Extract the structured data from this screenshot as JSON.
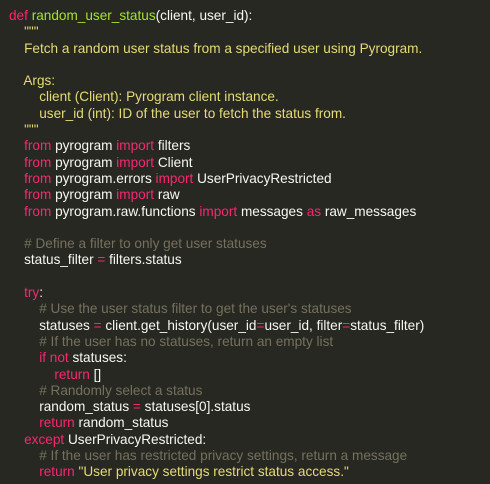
{
  "editor": {
    "background": "#272822",
    "colors": {
      "keyword": "#f92672",
      "function": "#a6e22e",
      "string": "#e6db74",
      "comment": "#75715e",
      "text": "#f8f8f2"
    },
    "lines": [
      [
        {
          "t": "def",
          "c": "kw"
        },
        {
          "t": " ",
          "c": "pl"
        },
        {
          "t": "random_user_status",
          "c": "fn"
        },
        {
          "t": "(client, user_id):",
          "c": "pl"
        }
      ],
      [
        {
          "t": "    \"\"\"",
          "c": "doc"
        }
      ],
      [
        {
          "t": "    Fetch a random user status from a specified user using Pyrogram.",
          "c": "doc"
        }
      ],
      [
        {
          "t": "",
          "c": "pl"
        }
      ],
      [
        {
          "t": "    Args:",
          "c": "doc"
        }
      ],
      [
        {
          "t": "        client (Client): Pyrogram client instance.",
          "c": "doc"
        }
      ],
      [
        {
          "t": "        user_id (int): ID of the user to fetch the status from.",
          "c": "doc"
        }
      ],
      [
        {
          "t": "    \"\"\"",
          "c": "doc"
        }
      ],
      [
        {
          "t": "    ",
          "c": "pl"
        },
        {
          "t": "from",
          "c": "kw"
        },
        {
          "t": " pyrogram ",
          "c": "pl"
        },
        {
          "t": "import",
          "c": "kw"
        },
        {
          "t": " filters",
          "c": "pl"
        }
      ],
      [
        {
          "t": "    ",
          "c": "pl"
        },
        {
          "t": "from",
          "c": "kw"
        },
        {
          "t": " pyrogram ",
          "c": "pl"
        },
        {
          "t": "import",
          "c": "kw"
        },
        {
          "t": " Client",
          "c": "pl"
        }
      ],
      [
        {
          "t": "    ",
          "c": "pl"
        },
        {
          "t": "from",
          "c": "kw"
        },
        {
          "t": " pyrogram.errors ",
          "c": "pl"
        },
        {
          "t": "import",
          "c": "kw"
        },
        {
          "t": " UserPrivacyRestricted",
          "c": "pl"
        }
      ],
      [
        {
          "t": "    ",
          "c": "pl"
        },
        {
          "t": "from",
          "c": "kw"
        },
        {
          "t": " pyrogram ",
          "c": "pl"
        },
        {
          "t": "import",
          "c": "kw"
        },
        {
          "t": " raw",
          "c": "pl"
        }
      ],
      [
        {
          "t": "    ",
          "c": "pl"
        },
        {
          "t": "from",
          "c": "kw"
        },
        {
          "t": " pyrogram.raw.functions ",
          "c": "pl"
        },
        {
          "t": "import",
          "c": "kw"
        },
        {
          "t": " messages ",
          "c": "pl"
        },
        {
          "t": "as",
          "c": "kw"
        },
        {
          "t": " raw_messages",
          "c": "pl"
        }
      ],
      [
        {
          "t": "",
          "c": "pl"
        }
      ],
      [
        {
          "t": "    # Define a filter to only get user statuses",
          "c": "cmt"
        }
      ],
      [
        {
          "t": "    status_filter ",
          "c": "pl"
        },
        {
          "t": "=",
          "c": "kw"
        },
        {
          "t": " filters.status",
          "c": "pl"
        }
      ],
      [
        {
          "t": "",
          "c": "pl"
        }
      ],
      [
        {
          "t": "    ",
          "c": "pl"
        },
        {
          "t": "try",
          "c": "kw"
        },
        {
          "t": ":",
          "c": "pl"
        }
      ],
      [
        {
          "t": "        # Use the user status filter to get the user's statuses",
          "c": "cmt"
        }
      ],
      [
        {
          "t": "        statuses ",
          "c": "pl"
        },
        {
          "t": "=",
          "c": "kw"
        },
        {
          "t": " client.get_history(user_id",
          "c": "pl"
        },
        {
          "t": "=",
          "c": "kw"
        },
        {
          "t": "user_id, filter",
          "c": "pl"
        },
        {
          "t": "=",
          "c": "kw"
        },
        {
          "t": "status_filter)",
          "c": "pl"
        }
      ],
      [
        {
          "t": "        # If the user has no statuses, return an empty list",
          "c": "cmt"
        }
      ],
      [
        {
          "t": "        ",
          "c": "pl"
        },
        {
          "t": "if",
          "c": "kw"
        },
        {
          "t": " ",
          "c": "pl"
        },
        {
          "t": "not",
          "c": "kw"
        },
        {
          "t": " statuses:",
          "c": "pl"
        }
      ],
      [
        {
          "t": "            ",
          "c": "pl"
        },
        {
          "t": "return",
          "c": "kw"
        },
        {
          "t": " []",
          "c": "pl"
        }
      ],
      [
        {
          "t": "        # Randomly select a status",
          "c": "cmt"
        }
      ],
      [
        {
          "t": "        random_status ",
          "c": "pl"
        },
        {
          "t": "=",
          "c": "kw"
        },
        {
          "t": " statuses[0].status",
          "c": "pl"
        }
      ],
      [
        {
          "t": "        ",
          "c": "pl"
        },
        {
          "t": "return",
          "c": "kw"
        },
        {
          "t": " random_status",
          "c": "pl"
        }
      ],
      [
        {
          "t": "    ",
          "c": "pl"
        },
        {
          "t": "except",
          "c": "kw"
        },
        {
          "t": " UserPrivacyRestricted:",
          "c": "pl"
        }
      ],
      [
        {
          "t": "        # If the user has restricted privacy settings, return a message",
          "c": "cmt"
        }
      ],
      [
        {
          "t": "        ",
          "c": "pl"
        },
        {
          "t": "return",
          "c": "kw"
        },
        {
          "t": " ",
          "c": "pl"
        },
        {
          "t": "\"User privacy settings restrict status access.\"",
          "c": "str"
        }
      ]
    ]
  }
}
